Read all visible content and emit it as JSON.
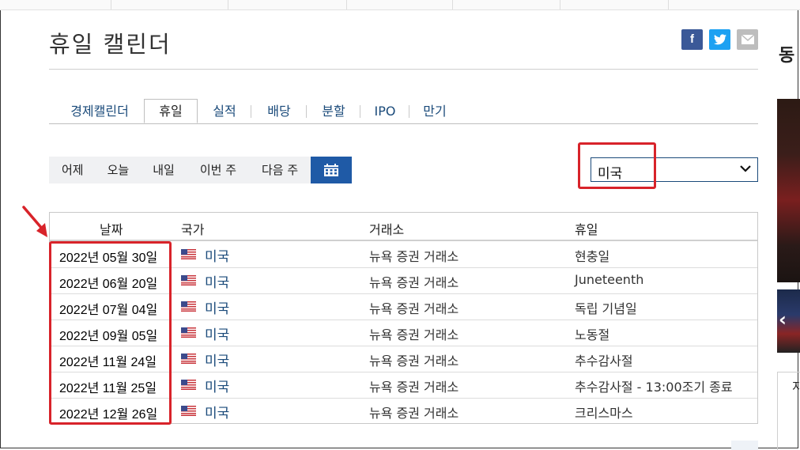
{
  "page": {
    "title": "휴일 캘린더"
  },
  "share": {
    "facebook_icon": "f",
    "twitter_icon": "twitter-bird",
    "email_icon": "envelope"
  },
  "tabs": [
    {
      "label": "경제캘린더",
      "active": false
    },
    {
      "label": "휴일",
      "active": true
    },
    {
      "label": "실적",
      "active": false
    },
    {
      "label": "배당",
      "active": false
    },
    {
      "label": "분할",
      "active": false
    },
    {
      "label": "IPO",
      "active": false
    },
    {
      "label": "만기",
      "active": false
    }
  ],
  "day_filters": [
    "어제",
    "오늘",
    "내일",
    "이번 주",
    "다음 주"
  ],
  "calendar_button_icon": "calendar-icon",
  "country_select": {
    "value": "미국"
  },
  "table": {
    "headers": {
      "date": "날짜",
      "country": "국가",
      "exchange": "거래소",
      "holiday": "휴일"
    },
    "rows": [
      {
        "date": "2022년 05월 30일",
        "country": "미국",
        "exchange": "뉴욕 증권 거래소",
        "holiday": "현충일"
      },
      {
        "date": "2022년 06월 20일",
        "country": "미국",
        "exchange": "뉴욕 증권 거래소",
        "holiday": "Juneteenth"
      },
      {
        "date": "2022년 07월 04일",
        "country": "미국",
        "exchange": "뉴욕 증권 거래소",
        "holiday": "독립 기념일"
      },
      {
        "date": "2022년 09월 05일",
        "country": "미국",
        "exchange": "뉴욕 증권 거래소",
        "holiday": "노동절"
      },
      {
        "date": "2022년 11월 24일",
        "country": "미국",
        "exchange": "뉴욕 증권 거래소",
        "holiday": "추수감사절"
      },
      {
        "date": "2022년 11월 25일",
        "country": "미국",
        "exchange": "뉴욕 증권 거래소",
        "holiday": "추수감사절 - 13:00조기 종료"
      },
      {
        "date": "2022년 12월 26일",
        "country": "미국",
        "exchange": "뉴욕 증권 거래소",
        "holiday": "크리스마스"
      }
    ]
  },
  "sidebar": {
    "title_fragment": "동",
    "box_label_fragment": "지"
  },
  "colors": {
    "accent": "#1f5aa6",
    "annotation_red": "#d8232a",
    "link": "#1a4a7a"
  }
}
